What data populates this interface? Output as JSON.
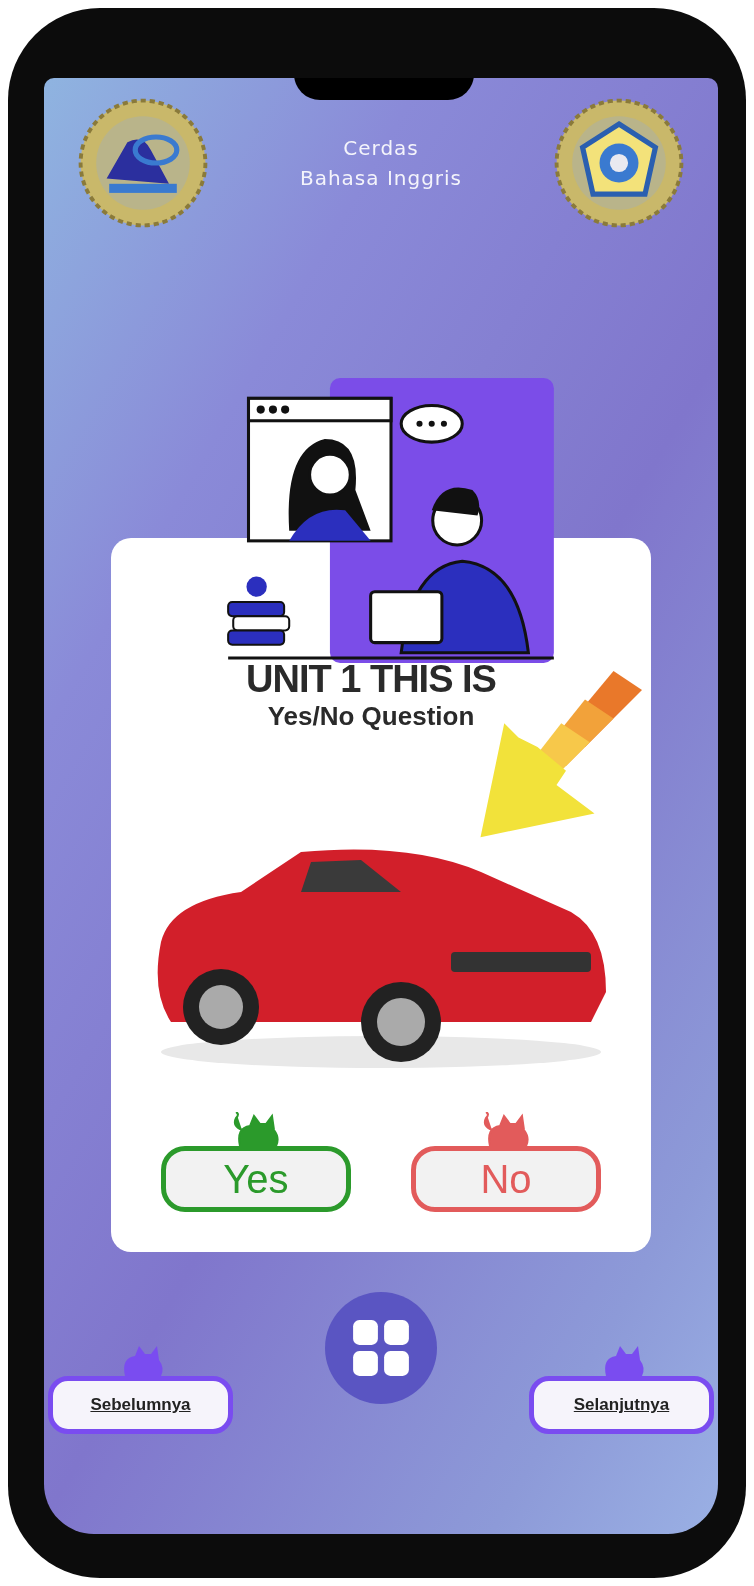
{
  "header": {
    "title_lines": [
      "Cerdas",
      "Bahasa Inggris"
    ]
  },
  "lesson": {
    "unit_title": "UNIT 1 THIS IS",
    "subtitle": "Yes/No Question"
  },
  "answers": [
    {
      "label": "Yes",
      "color": "#2b9a2b"
    },
    {
      "label": "No",
      "color": "#e25b5b"
    }
  ],
  "navigation": {
    "previous": "Sebelumnya",
    "next": "Selanjutnya"
  }
}
